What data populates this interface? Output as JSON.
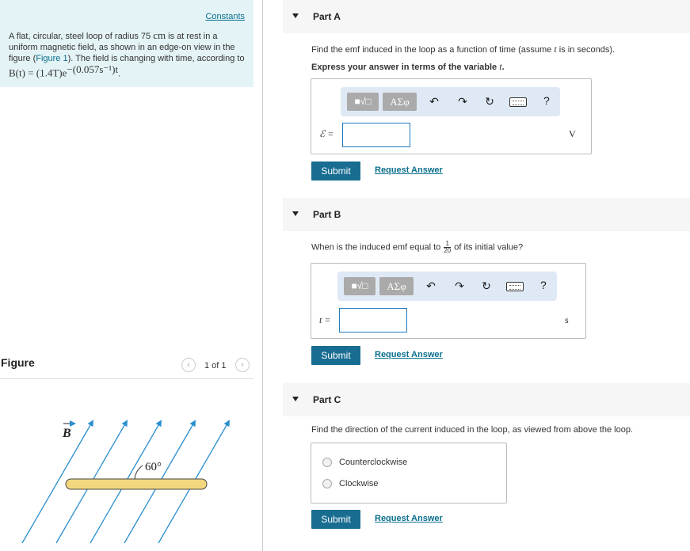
{
  "problem": {
    "constants_label": "Constants",
    "text_1": "A flat, circular, steel loop of radius 75 ",
    "radius_unit": "cm",
    "text_2": " is at rest in a uniform magnetic field, as shown in an edge-on view in the figure (",
    "figure_link": "Figure 1",
    "text_3": "). The field is changing with time, according to ",
    "field_eq_lhs": "B(t) = (1.4T)e",
    "field_eq_exp": "−(0.057s⁻¹)t",
    "text_4": "."
  },
  "figure": {
    "title": "Figure",
    "pager_text": "1 of 1",
    "prev_icon": "‹",
    "next_icon": "›",
    "field_label": "B",
    "angle_label": "60°"
  },
  "toolbar": {
    "templates_label": "■√□",
    "greek_label": "ΑΣφ",
    "undo_icon": "↶",
    "redo_icon": "↷",
    "reset_icon": "↻",
    "help_label": "?"
  },
  "parts": [
    {
      "title": "Part A",
      "prompt_1": "Find the emf induced in the loop as a function of time (assume ",
      "prompt_var": "t",
      "prompt_2": " is in seconds).",
      "instruction": "Express your answer in terms of the variable ",
      "instruction_var": "t",
      "instruction_end": ".",
      "variable": "ℰ =",
      "unit": "V",
      "input_value": "",
      "submit_label": "Submit",
      "request_label": "Request Answer"
    },
    {
      "title": "Part B",
      "prompt_1": "When is the induced emf equal to ",
      "frac_num": "1",
      "frac_den": "20",
      "prompt_2": " of its initial value?",
      "variable": "t =",
      "unit": "s",
      "input_value": "",
      "submit_label": "Submit",
      "request_label": "Request Answer"
    },
    {
      "title": "Part C",
      "prompt_1": "Find the direction of the current induced in the loop, as viewed from above the loop.",
      "choices": [
        "Counterclockwise",
        "Clockwise"
      ],
      "submit_label": "Submit",
      "request_label": "Request Answer"
    }
  ]
}
